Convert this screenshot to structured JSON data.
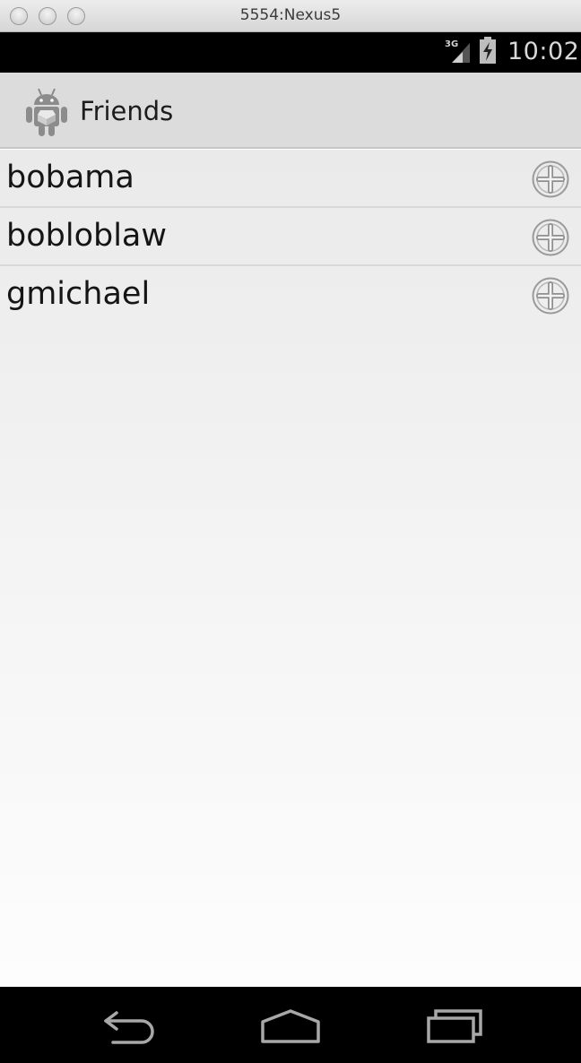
{
  "window": {
    "title": "5554:Nexus5"
  },
  "status_bar": {
    "network": "3G",
    "time": "10:02"
  },
  "action_bar": {
    "title": "Friends"
  },
  "friends": [
    {
      "name": "bobama"
    },
    {
      "name": "bobloblaw"
    },
    {
      "name": "gmichael"
    }
  ],
  "icons": {
    "app": "android-robot-icon",
    "add": "add-circle-icon",
    "back": "back-icon",
    "home": "home-icon",
    "recents": "recents-icon"
  },
  "colors": {
    "statusbar": "#000000",
    "actionbar": "#dcdcdc",
    "text": "#151515"
  }
}
